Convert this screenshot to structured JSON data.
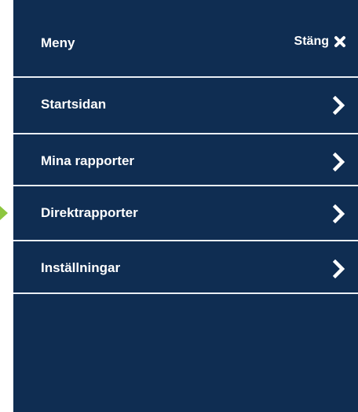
{
  "menu": {
    "title": "Meny",
    "close_label": "Stäng",
    "close_icon": "close-x-icon",
    "chevron_icon": "chevron-right-icon",
    "colors": {
      "panel_bg": "#0f2d52",
      "divider": "#e9eef5",
      "text": "#ffffff",
      "active_marker": "#8dc63f"
    },
    "active_item": "Direktrapporter",
    "items": [
      {
        "label": "Startsidan"
      },
      {
        "label": "Mina rapporter"
      },
      {
        "label": "Direktrapporter"
      },
      {
        "label": "Inställningar"
      }
    ]
  }
}
